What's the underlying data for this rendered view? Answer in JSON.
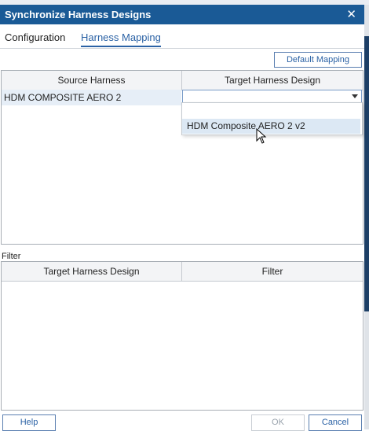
{
  "window": {
    "title": "Synchronize Harness Designs"
  },
  "tabs": [
    {
      "label": "Configuration",
      "active": false
    },
    {
      "label": "Harness Mapping",
      "active": true
    }
  ],
  "buttons": {
    "default_mapping": "Default Mapping",
    "help": "Help",
    "ok": "OK",
    "cancel": "Cancel"
  },
  "mapping_table": {
    "columns": [
      "Source Harness",
      "Target Harness Design"
    ],
    "rows": [
      {
        "source": "HDM COMPOSITE AERO 2",
        "target": ""
      }
    ],
    "dropdown_options": [
      "",
      "HDM Composite AERO 2 v2"
    ],
    "highlighted_option": "HDM Composite AERO 2 v2"
  },
  "filter": {
    "label": "Filter",
    "columns": [
      "Target Harness Design",
      "Filter"
    ]
  },
  "colors": {
    "titlebar": "#1a5a96",
    "accent": "#2b62a5",
    "selection": "#dce8f4"
  }
}
